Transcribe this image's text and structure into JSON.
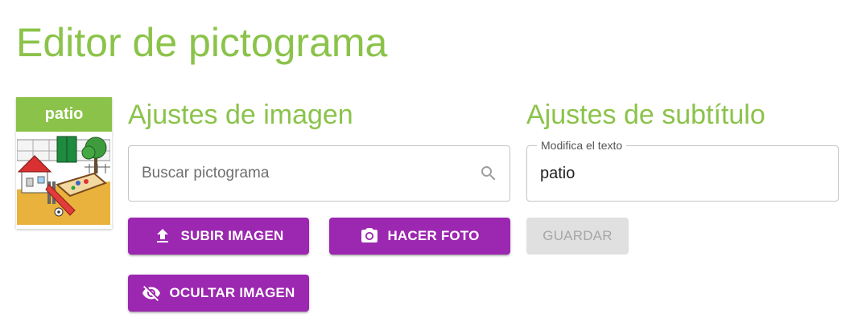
{
  "page": {
    "title": "Editor de pictograma"
  },
  "pictogram": {
    "caption": "patio"
  },
  "image_settings": {
    "title": "Ajustes de imagen",
    "search_placeholder": "Buscar pictograma",
    "upload_label": "SUBIR IMAGEN",
    "photo_label": "HACER FOTO",
    "hide_label": "OCULTAR IMAGEN"
  },
  "subtitle_settings": {
    "title": "Ajustes de subtítulo",
    "field_label": "Modifica el texto",
    "field_value": "patio",
    "save_label": "GUARDAR"
  },
  "icons": {
    "search": "search-icon",
    "upload": "upload-icon",
    "camera": "camera-icon",
    "hide": "eye-off-icon"
  },
  "colors": {
    "accent_green": "#8bc34a",
    "button_purple": "#9c27b0",
    "disabled_gray": "#e0e0e0"
  }
}
